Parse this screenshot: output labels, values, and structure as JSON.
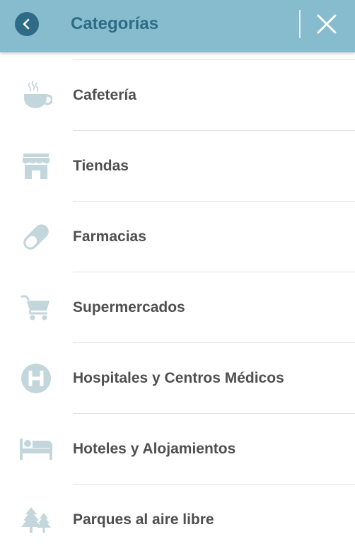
{
  "header": {
    "title": "Categorías",
    "back_icon": "chevron-left-icon",
    "close_icon": "close-icon"
  },
  "colors": {
    "header_bg": "#86bccd",
    "header_accent": "#2f6b86",
    "icon": "#c2d6dc",
    "label": "#4f4f4f"
  },
  "categories": [
    {
      "label": "Cafetería",
      "icon": "coffee-cup-icon"
    },
    {
      "label": "Tiendas",
      "icon": "store-icon"
    },
    {
      "label": "Farmacias",
      "icon": "pill-icon"
    },
    {
      "label": "Supermercados",
      "icon": "shopping-cart-icon"
    },
    {
      "label": "Hospitales y Centros Médicos",
      "icon": "hospital-icon"
    },
    {
      "label": "Hoteles y Alojamientos",
      "icon": "bed-icon"
    },
    {
      "label": "Parques al aire libre",
      "icon": "trees-icon"
    }
  ]
}
